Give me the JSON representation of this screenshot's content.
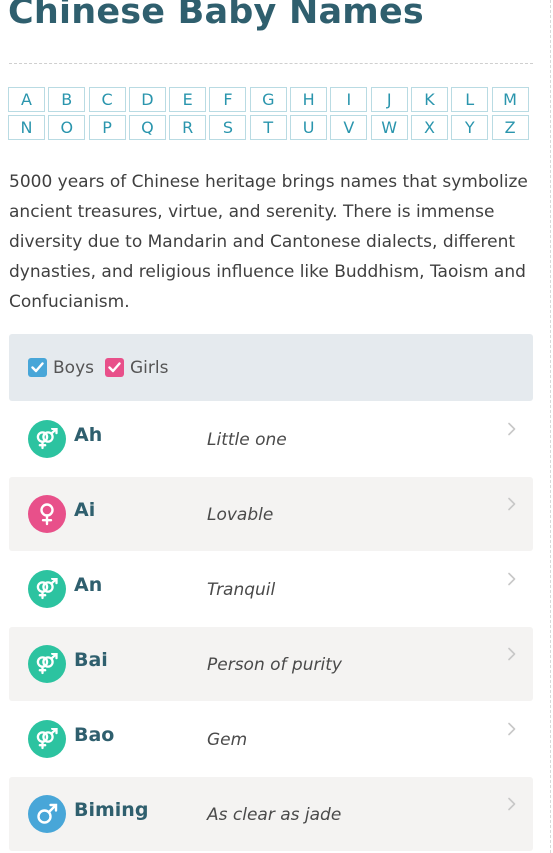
{
  "page": {
    "title": "Chinese Baby Names",
    "intro": "5000 years of Chinese heritage brings names that symbolize ancient treasures, virtue, and serenity. There is immense diversity due to Mandarin and Cantonese dialects, different dynasties, and religious influence like Buddhism, Taoism and Confucianism."
  },
  "alphabet": [
    "A",
    "B",
    "C",
    "D",
    "E",
    "F",
    "G",
    "H",
    "I",
    "J",
    "K",
    "L",
    "M",
    "N",
    "O",
    "P",
    "Q",
    "R",
    "S",
    "T",
    "U",
    "V",
    "W",
    "X",
    "Y",
    "Z"
  ],
  "filters": {
    "boys": {
      "label": "Boys",
      "checked": true,
      "color": "#48a6d8"
    },
    "girls": {
      "label": "Girls",
      "checked": true,
      "color": "#e8508a"
    }
  },
  "colors": {
    "title": "#2f5f6e",
    "letter": "#2a95ad",
    "unisex": "#2cc3a0",
    "girl": "#e8508a",
    "boy": "#48a6d8"
  },
  "names": [
    {
      "name": "Ah",
      "meaning": "Little one",
      "gender": "unisex",
      "icon": "unisex-gender-icon"
    },
    {
      "name": "Ai",
      "meaning": "Lovable",
      "gender": "girl",
      "icon": "female-gender-icon"
    },
    {
      "name": "An",
      "meaning": "Tranquil",
      "gender": "unisex",
      "icon": "unisex-gender-icon"
    },
    {
      "name": "Bai",
      "meaning": "Person of purity",
      "gender": "unisex",
      "icon": "unisex-gender-icon"
    },
    {
      "name": "Bao",
      "meaning": "Gem",
      "gender": "unisex",
      "icon": "unisex-gender-icon"
    },
    {
      "name": "Biming",
      "meaning": "As clear as jade",
      "gender": "boy",
      "icon": "male-gender-icon"
    }
  ]
}
